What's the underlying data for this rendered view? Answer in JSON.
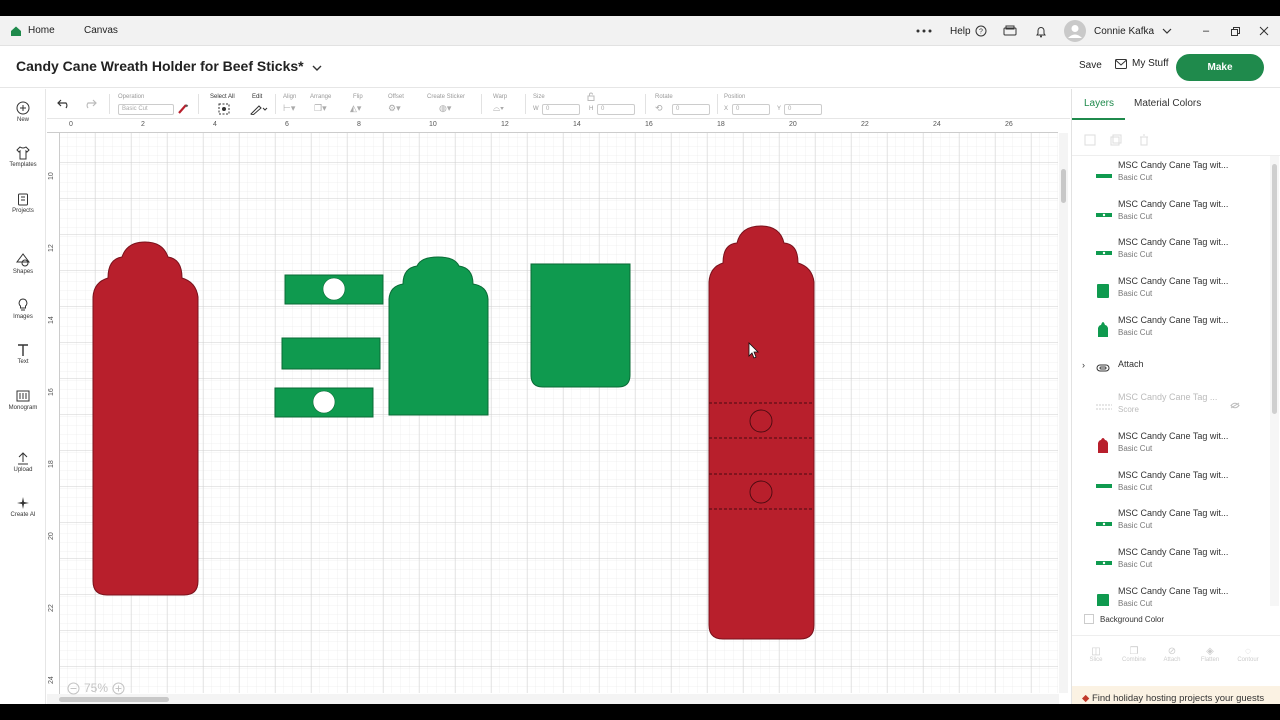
{
  "tabs": {
    "home": "Home",
    "canvas": "Canvas"
  },
  "topbar": {
    "help": "Help",
    "user": "Connie Kafka"
  },
  "project": {
    "title": "Candy Cane Wreath Holder for Beef Sticks*"
  },
  "actions": {
    "save": "Save",
    "my_stuff": "My Stuff",
    "make": "Make"
  },
  "leftbar": {
    "new": "New",
    "templates": "Templates",
    "projects": "Projects",
    "shapes": "Shapes",
    "images": "Images",
    "text": "Text",
    "monogram": "Monogram",
    "upload": "Upload",
    "create_ai": "Create AI"
  },
  "toolbar": {
    "operation_label": "Operation",
    "operation_value": "Basic Cut",
    "select_all": "Select All",
    "edit": "Edit",
    "align": "Align",
    "arrange": "Arrange",
    "flip": "Flip",
    "offset": "Offset",
    "create_sticker": "Create Sticker",
    "warp": "Warp",
    "size": "Size",
    "w_label": "W",
    "w_value": "0",
    "h_label": "H",
    "h_value": "0",
    "rotate": "Rotate",
    "rotate_value": "0",
    "position": "Position",
    "x_label": "X",
    "x_value": "0",
    "y_label": "Y",
    "y_value": "0"
  },
  "ruler": {
    "top": [
      "0",
      "2",
      "4",
      "6",
      "8",
      "10",
      "12",
      "14",
      "16",
      "18",
      "20",
      "22",
      "24",
      "26"
    ],
    "left": [
      "10",
      "12",
      "14",
      "16",
      "18",
      "20",
      "22",
      "24"
    ]
  },
  "zoom": {
    "value": "75%"
  },
  "panel": {
    "tab_layers": "Layers",
    "tab_materials": "Material Colors",
    "layers": [
      {
        "name": "MSC Candy Cane Tag wit...",
        "sub": "Basic Cut",
        "thumb": "green-bar"
      },
      {
        "name": "MSC Candy Cane Tag wit...",
        "sub": "Basic Cut",
        "thumb": "green-bar-hole"
      },
      {
        "name": "MSC Candy Cane Tag wit...",
        "sub": "Basic Cut",
        "thumb": "green-bar-hole"
      },
      {
        "name": "MSC Candy Cane Tag wit...",
        "sub": "Basic Cut",
        "thumb": "green-rect"
      },
      {
        "name": "MSC Candy Cane Tag wit...",
        "sub": "Basic Cut",
        "thumb": "green-tag"
      },
      {
        "name": "Attach",
        "sub": "",
        "thumb": "attach"
      },
      {
        "name": "MSC Candy Cane Tag ...",
        "sub": "Score",
        "thumb": "score"
      },
      {
        "name": "MSC Candy Cane Tag wit...",
        "sub": "Basic Cut",
        "thumb": "red-tag"
      },
      {
        "name": "MSC Candy Cane Tag wit...",
        "sub": "Basic Cut",
        "thumb": "green-bar"
      },
      {
        "name": "MSC Candy Cane Tag wit...",
        "sub": "Basic Cut",
        "thumb": "green-bar-hole"
      },
      {
        "name": "MSC Candy Cane Tag wit...",
        "sub": "Basic Cut",
        "thumb": "green-bar-hole"
      },
      {
        "name": "MSC Candy Cane Tag wit...",
        "sub": "Basic Cut",
        "thumb": "green-rect"
      }
    ],
    "background_color": "Background Color",
    "bottom_actions": [
      "Slice",
      "Combine",
      "Attach",
      "Flatten",
      "Contour"
    ],
    "promo": "Find holiday hosting projects your guests will love."
  },
  "colors": {
    "brand": "#1f8a4c",
    "red": "#b81f2c",
    "green": "#0f9a4f"
  }
}
